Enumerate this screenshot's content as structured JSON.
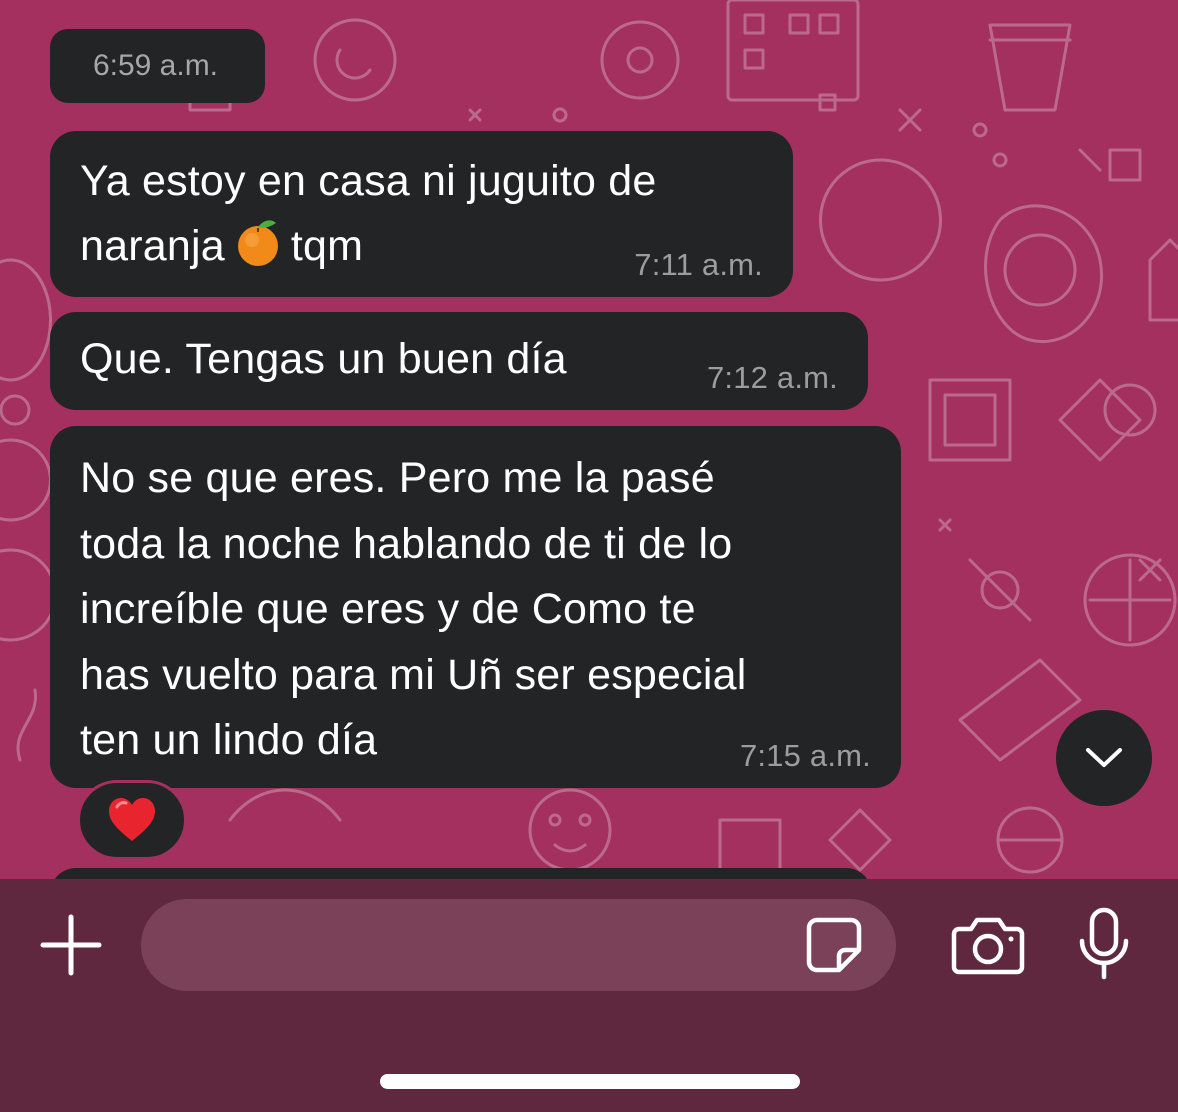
{
  "chat": {
    "date_chip": "6:59 a.m.",
    "messages": [
      {
        "text_before_emoji": "Ya estoy en casa ni juguito de\nnaranja",
        "emoji": "orange-emoji",
        "text_after_emoji": "tqm",
        "time": "7:11 a.m."
      },
      {
        "text": "Que. Tengas un buen día",
        "time": "7:12 a.m."
      },
      {
        "text": "No se que eres. Pero me la pasé\ntoda la noche hablando de ti de lo\nincreíble que eres y de Como te\nhas vuelto para mi Uñ ser especial\nten un lindo día",
        "time": "7:15 a.m.",
        "reaction": "❤️"
      }
    ],
    "scroll_down_icon": "chevron-down-icon"
  },
  "composer": {
    "input_value": "",
    "icons": [
      "plus-icon",
      "sticker-icon",
      "camera-icon",
      "microphone-icon"
    ]
  },
  "colors": {
    "wallpaper": "#a3305f",
    "bubble": "#232425",
    "composer_bar": "#60283f",
    "input_field": "#7a4158",
    "timestamp_text": "#9c9d9f"
  }
}
